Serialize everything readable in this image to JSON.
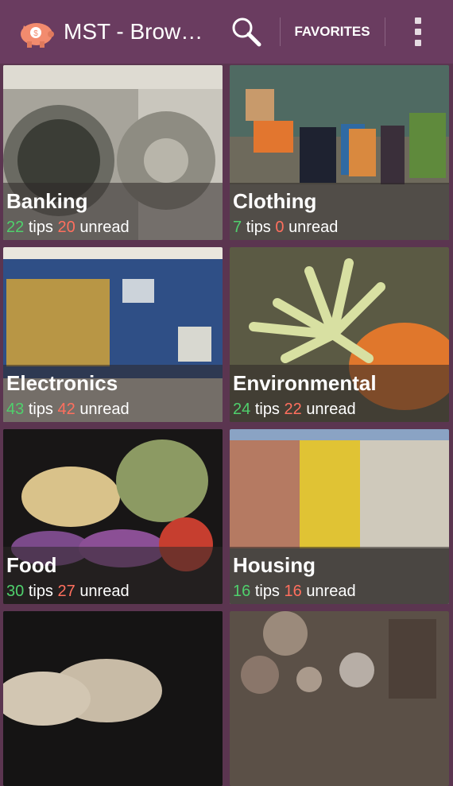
{
  "appbar": {
    "title": "MST - Brow…",
    "favorites_label": "FAVORITES",
    "logo_icon": "piggy-bank-icon",
    "search_icon": "search-icon",
    "menu_icon": "overflow-menu-icon",
    "background": "#6a3c60"
  },
  "colors": {
    "tips_count": "#4fd06c",
    "unread_count": "#ff6f5e"
  },
  "categories": [
    {
      "name": "Banking",
      "tips": "22",
      "tips_word": "tips",
      "unread": "20",
      "unread_word": "unread"
    },
    {
      "name": "Clothing",
      "tips": "7",
      "tips_word": "tips",
      "unread": "0",
      "unread_word": "unread"
    },
    {
      "name": "Electronics",
      "tips": "43",
      "tips_word": "tips",
      "unread": "42",
      "unread_word": "unread"
    },
    {
      "name": "Environmental",
      "tips": "24",
      "tips_word": "tips",
      "unread": "22",
      "unread_word": "unread"
    },
    {
      "name": "Food",
      "tips": "30",
      "tips_word": "tips",
      "unread": "27",
      "unread_word": "unread"
    },
    {
      "name": "Housing",
      "tips": "16",
      "tips_word": "tips",
      "unread": "16",
      "unread_word": "unread"
    },
    {
      "name": "",
      "tips": "",
      "tips_word": "",
      "unread": "",
      "unread_word": ""
    },
    {
      "name": "",
      "tips": "",
      "tips_word": "",
      "unread": "",
      "unread_word": ""
    }
  ]
}
